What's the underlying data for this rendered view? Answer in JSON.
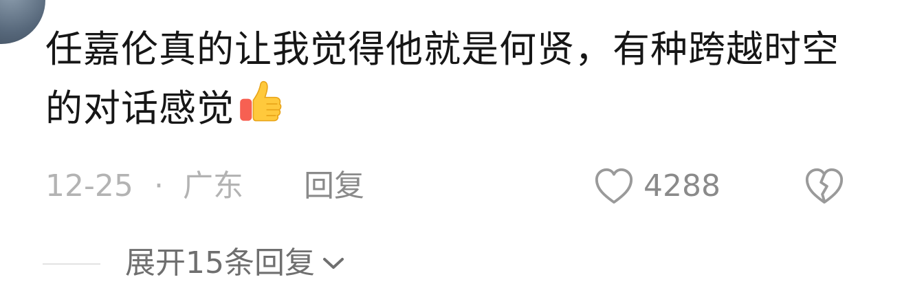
{
  "comment": {
    "text": "任嘉伦真的让我觉得他就是何贤，有种跨越时空的对话感觉",
    "emoji": "thumbs-up"
  },
  "meta": {
    "date": "12-25",
    "separator": "·",
    "location": "广东",
    "reply_label": "回复"
  },
  "actions": {
    "like_count": "4288",
    "like_icon": "heart-outline-icon",
    "dislike_icon": "broken-heart-icon"
  },
  "replies": {
    "expand_label": "展开15条回复",
    "expand_icon": "chevron-down-icon"
  },
  "colors": {
    "text_primary": "#161616",
    "text_secondary": "#b3b3b3",
    "text_action": "#8a8a8a",
    "icon_stroke": "#9a9a9a"
  }
}
